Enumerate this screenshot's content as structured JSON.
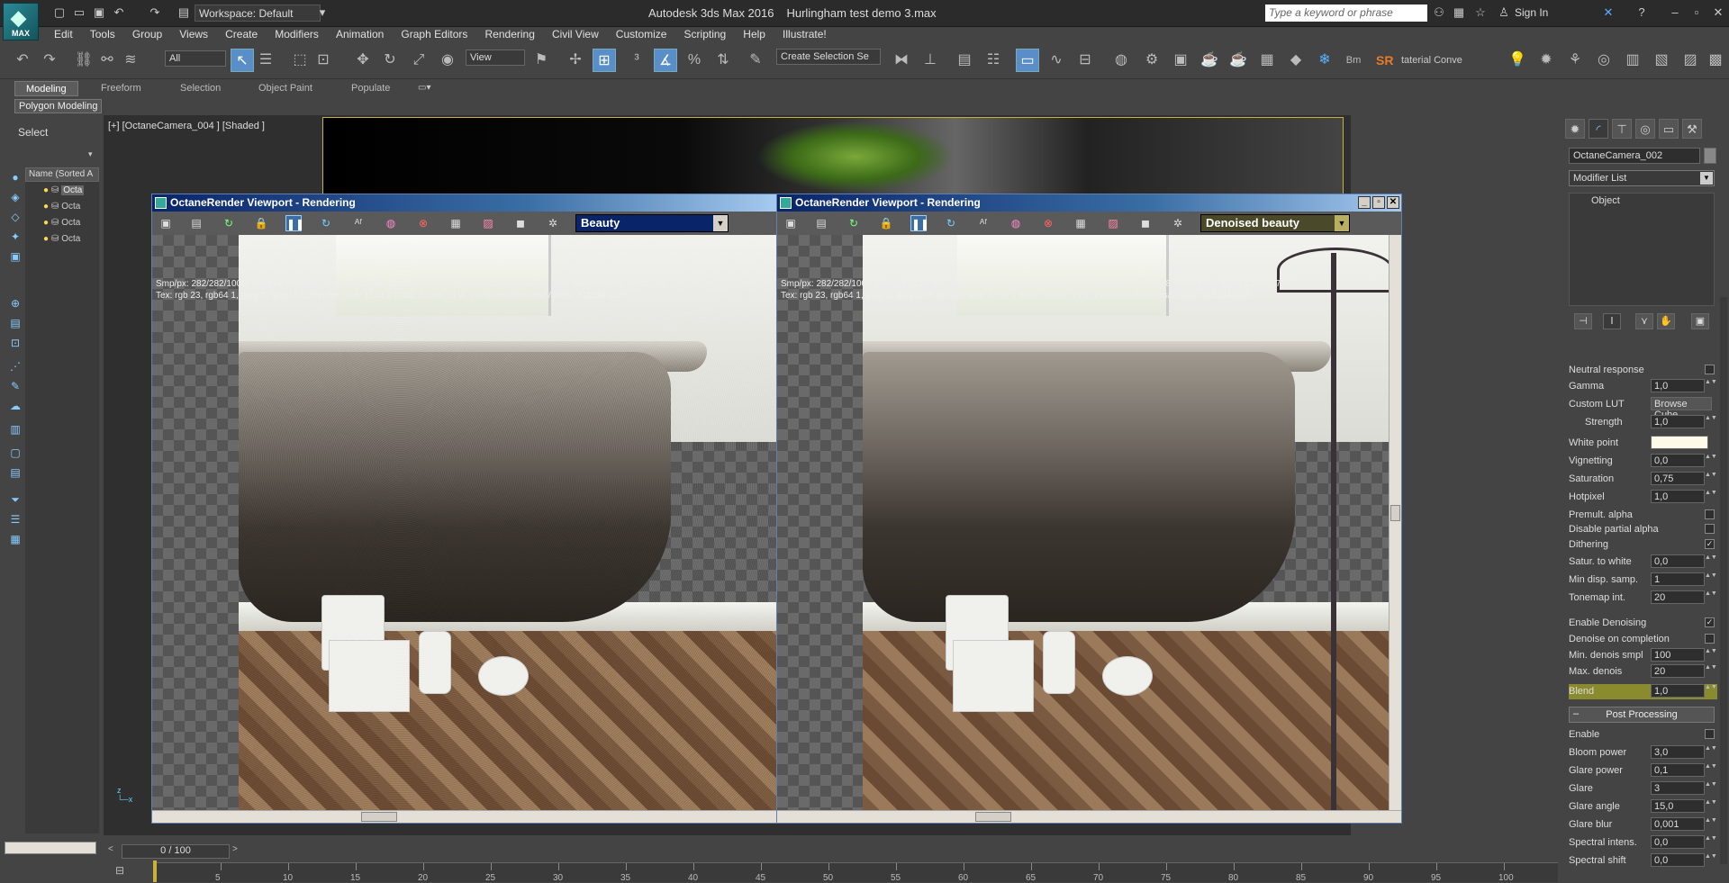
{
  "titlebar": {
    "logo_label": "MAX",
    "workspace": "Workspace: Default",
    "app_name": "Autodesk 3ds Max 2016",
    "file_name": "Hurlingham test demo 3.max",
    "search_placeholder": "Type a keyword or phrase",
    "signin": "Sign In"
  },
  "menus": [
    "Edit",
    "Tools",
    "Group",
    "Views",
    "Create",
    "Modifiers",
    "Animation",
    "Graph Editors",
    "Rendering",
    "Civil View",
    "Customize",
    "Scripting",
    "Help",
    "Illustrate!"
  ],
  "toolbar": {
    "filter": "All",
    "view": "View",
    "selection_set": "Create Selection Se",
    "material_conv": "taterial Conve",
    "sr_label": "SR"
  },
  "ribbon": {
    "tabs": [
      "Modeling",
      "Freeform",
      "Selection",
      "Object Paint",
      "Populate"
    ],
    "active_panel": "Polygon Modeling"
  },
  "left": {
    "select_label": "Select",
    "explorer_header": "Name (Sorted A",
    "items": [
      "Octa",
      "Octa",
      "Octa",
      "Octa"
    ]
  },
  "viewport": {
    "label": "[+] [OctaneCamera_004 ] [Shaded ]"
  },
  "render_left": {
    "title": "OctaneRender Viewport - Rendering",
    "pass": "Beauty",
    "info1": "Smp/px: 282/282/1000.   Samp/s: 8,382M.   Time: 00:01:39 / 00:05:53.   Time left: 00:01:39 / 00:04:13.   GPU Mem [GB]: 2,287/3,755",
    "info2": "Tex: rgb 23, rgb64 1, grey 2, grey16 0.   Render size: 1753 x 1240.   Zoom: 71%.   Primitives/Meshes/Voxels: 4113943/1/0"
  },
  "render_right": {
    "title": "OctaneRender Viewport - Rendering",
    "pass": "Denoised beauty",
    "info1": "Smp/px: 282/282/1000.   Samp/s: 8,382M.   Time: 00:01:57 / 00:06:55.   Time left: 00:01:57 / 00:04:58.   GPU Mem [GB]: 2,287/3,755",
    "info2": "Tex: rgb 23, rgb64 1, grey 2, grey16 0.   Render size: 1753 x 1240.   Zoom: 71%.   Primitives/Meshes/Voxels: 4113943/1/0"
  },
  "command_panel": {
    "object_name": "OctaneCamera_002",
    "modifier_list": "Modifier List",
    "stack_item": "Object",
    "props": [
      {
        "label": "Neutral response",
        "type": "check",
        "value": ""
      },
      {
        "label": "Gamma",
        "type": "num",
        "value": "1,0"
      },
      {
        "label": "Custom LUT",
        "type": "button",
        "value": "Browse Cube..."
      },
      {
        "label": "Strength",
        "type": "num",
        "value": "1,0"
      },
      {
        "label": "White point",
        "type": "color",
        "value": ""
      },
      {
        "label": "Vignetting",
        "type": "num",
        "value": "0,0"
      },
      {
        "label": "Saturation",
        "type": "num",
        "value": "0,75"
      },
      {
        "label": "Hotpixel",
        "type": "num",
        "value": "1,0"
      },
      {
        "label": "Premult. alpha",
        "type": "check",
        "value": ""
      },
      {
        "label": "Disable partial alpha",
        "type": "check",
        "value": ""
      },
      {
        "label": "Dithering",
        "type": "check",
        "value": "✓"
      },
      {
        "label": "Satur. to white",
        "type": "num",
        "value": "0,0"
      },
      {
        "label": "Min disp. samp.",
        "type": "num",
        "value": "1"
      },
      {
        "label": "Tonemap int.",
        "type": "num",
        "value": "20"
      },
      {
        "label": "Enable Denoising",
        "type": "check",
        "value": "✓"
      },
      {
        "label": "Denoise on completion",
        "type": "check",
        "value": ""
      },
      {
        "label": "Min. denois smpl",
        "type": "num",
        "value": "100"
      },
      {
        "label": "Max. denois",
        "type": "num",
        "value": "20"
      },
      {
        "label": "Blend",
        "type": "num",
        "value": "1,0"
      }
    ],
    "post_processing": "Post Processing",
    "post_props": [
      {
        "label": "Enable",
        "type": "check",
        "value": ""
      },
      {
        "label": "Bloom power",
        "type": "num",
        "value": "3,0"
      },
      {
        "label": "Glare power",
        "type": "num",
        "value": "0,1"
      },
      {
        "label": "Glare",
        "type": "num",
        "value": "3"
      },
      {
        "label": "Glare angle",
        "type": "num",
        "value": "15,0"
      },
      {
        "label": "Glare blur",
        "type": "num",
        "value": "0,001"
      },
      {
        "label": "Spectral intens.",
        "type": "num",
        "value": "0,0"
      },
      {
        "label": "Spectral shift",
        "type": "num",
        "value": "0,0"
      }
    ]
  },
  "timeline": {
    "frame": "0 / 100",
    "ticks": [
      "5",
      "10",
      "15",
      "20",
      "25",
      "30",
      "35",
      "40",
      "45",
      "50",
      "55",
      "60",
      "65",
      "70",
      "75",
      "80",
      "85",
      "90",
      "95",
      "100"
    ]
  }
}
